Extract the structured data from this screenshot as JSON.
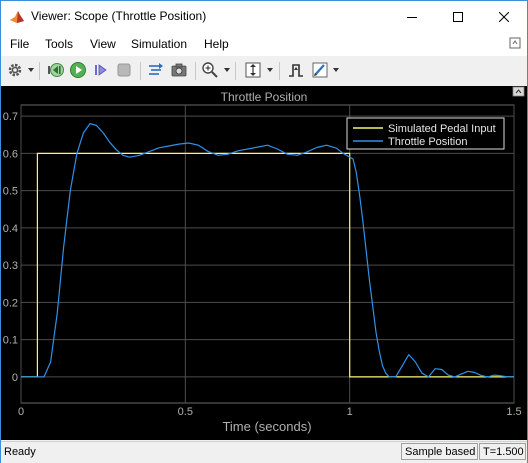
{
  "window": {
    "title": "Viewer: Scope (Throttle Position)",
    "icon": "matlab-simulink-icon",
    "controls": [
      "minimize-icon",
      "maximize-icon",
      "close-icon"
    ]
  },
  "menu": [
    "File",
    "Tools",
    "View",
    "Simulation",
    "Help"
  ],
  "toolbar": {
    "buttons": [
      "gear-icon",
      "step-back-icon",
      "run-icon",
      "step-forward-icon",
      "stop-icon",
      "highlight-signal-icon",
      "snapshot-icon",
      "zoom-icon",
      "scale-axes-icon",
      "triggers-icon",
      "style-icon"
    ]
  },
  "status": {
    "text": "Ready",
    "sample_mode": "Sample based",
    "time": "T=1.500"
  },
  "colors": {
    "plot_background": "#000000",
    "axes_background": "#000000",
    "grid": "#4d4d4d",
    "axis_text": "#b0b0b0",
    "pedal_line": "#f7f76e",
    "throttle_line": "#2e91ea"
  },
  "chart_data": {
    "type": "line",
    "title": "Throttle Position",
    "xlabel": "Time (seconds)",
    "ylabel": "",
    "xlim": [
      0,
      1.5
    ],
    "ylim": [
      -0.07,
      0.73
    ],
    "xticks": [
      0,
      0.5,
      1,
      1.5
    ],
    "xtick_labels": [
      "0",
      "0.5",
      "1",
      "1.5"
    ],
    "yticks": [
      0,
      0.1,
      0.2,
      0.3,
      0.4,
      0.5,
      0.6,
      0.7
    ],
    "ytick_labels": [
      "0",
      "0.1",
      "0.2",
      "0.3",
      "0.4",
      "0.5",
      "0.6",
      "0.7"
    ],
    "grid": true,
    "legend": "top-right",
    "series": [
      {
        "name": "Simulated Pedal Input",
        "color": "#f7f76e",
        "x": [
          0,
          0.05,
          0.05,
          1.0,
          1.0,
          1.5
        ],
        "y": [
          0,
          0,
          0.6,
          0.6,
          0,
          0
        ]
      },
      {
        "name": "Throttle Position",
        "color": "#2e91ea",
        "x": [
          0,
          0.07,
          0.09,
          0.11,
          0.13,
          0.15,
          0.17,
          0.19,
          0.21,
          0.23,
          0.25,
          0.27,
          0.29,
          0.31,
          0.33,
          0.36,
          0.39,
          0.42,
          0.45,
          0.48,
          0.51,
          0.54,
          0.57,
          0.6,
          0.63,
          0.66,
          0.69,
          0.72,
          0.75,
          0.78,
          0.81,
          0.84,
          0.87,
          0.9,
          0.93,
          0.96,
          0.98,
          1.0,
          1.01,
          1.02,
          1.03,
          1.04,
          1.05,
          1.06,
          1.07,
          1.08,
          1.09,
          1.1,
          1.11,
          1.12,
          1.14,
          1.16,
          1.18,
          1.2,
          1.22,
          1.24,
          1.26,
          1.28,
          1.3,
          1.32,
          1.34,
          1.36,
          1.38,
          1.4,
          1.42,
          1.44,
          1.46,
          1.48,
          1.5
        ],
        "y": [
          0,
          0,
          0.04,
          0.17,
          0.35,
          0.5,
          0.6,
          0.655,
          0.68,
          0.675,
          0.655,
          0.63,
          0.61,
          0.595,
          0.59,
          0.595,
          0.605,
          0.615,
          0.62,
          0.625,
          0.628,
          0.622,
          0.605,
          0.595,
          0.598,
          0.607,
          0.612,
          0.617,
          0.622,
          0.612,
          0.598,
          0.595,
          0.604,
          0.616,
          0.622,
          0.614,
          0.6,
          0.59,
          0.585,
          0.55,
          0.49,
          0.42,
          0.34,
          0.26,
          0.19,
          0.12,
          0.07,
          0.03,
          0.01,
          0.0,
          0.0,
          0.03,
          0.06,
          0.04,
          0.01,
          0.0,
          0.022,
          0.02,
          0.005,
          0.0,
          0.008,
          0.015,
          0.012,
          0.004,
          0.0,
          0.005,
          0.003,
          0.0,
          0.0
        ]
      }
    ]
  }
}
